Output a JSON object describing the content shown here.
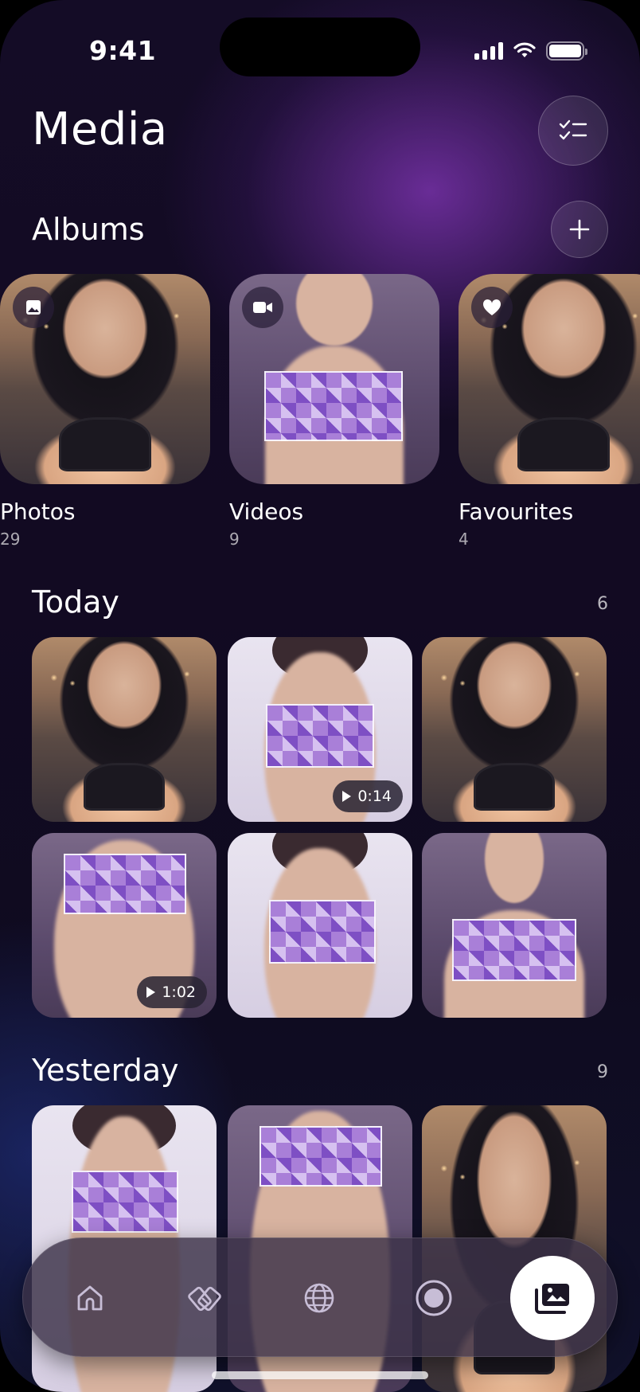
{
  "status_bar": {
    "time": "9:41",
    "signal_level": 4,
    "battery_level": 1.0
  },
  "header": {
    "title": "Media",
    "select_icon": "checklist-icon"
  },
  "albums": {
    "title": "Albums",
    "add_icon": "plus-icon",
    "items": [
      {
        "name": "Photos",
        "count": "29",
        "icon": "image-icon",
        "thumb": "photo"
      },
      {
        "name": "Videos",
        "count": "9",
        "icon": "video-camera-icon",
        "thumb": "silhouette-dark"
      },
      {
        "name": "Favourites",
        "count": "4",
        "icon": "heart-icon",
        "thumb": "photo"
      }
    ]
  },
  "today": {
    "title": "Today",
    "count": "6",
    "items": [
      {
        "kind": "photo"
      },
      {
        "kind": "video",
        "duration": "0:14"
      },
      {
        "kind": "photo"
      },
      {
        "kind": "video",
        "duration": "1:02"
      },
      {
        "kind": "image"
      },
      {
        "kind": "image"
      }
    ]
  },
  "yesterday": {
    "title": "Yesterday",
    "count": "9"
  },
  "tab_bar": {
    "items": [
      {
        "icon": "home-icon",
        "active": false
      },
      {
        "icon": "handshake-icon",
        "active": false
      },
      {
        "icon": "globe-icon",
        "active": false
      },
      {
        "icon": "record-icon",
        "active": false
      },
      {
        "icon": "media-library-icon",
        "active": true
      }
    ]
  },
  "colors": {
    "accent_purple": "#7e4fc4",
    "background": "#120a22",
    "tab_active": "#ffffff"
  }
}
